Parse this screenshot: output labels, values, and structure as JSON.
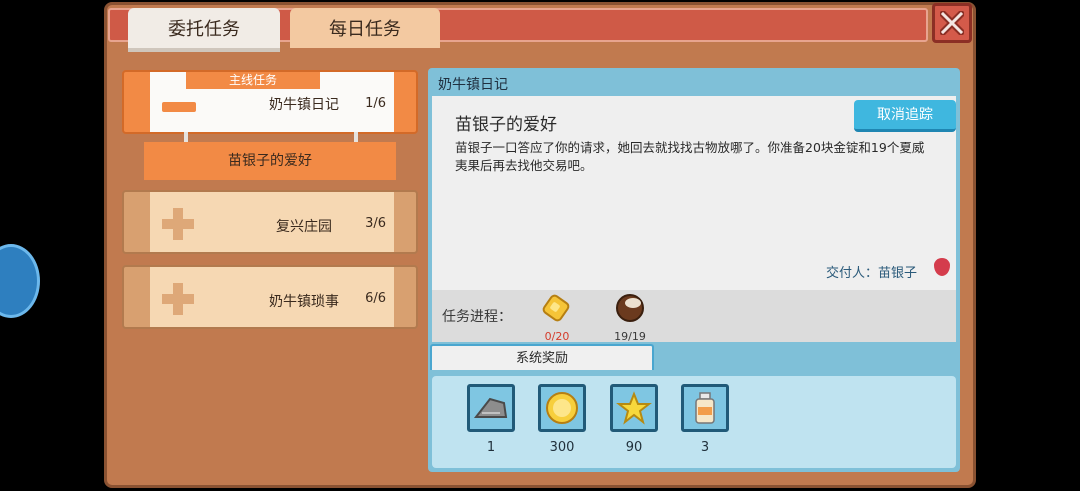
{
  "tabs": {
    "commission": "委托任务",
    "daily": "每日任务"
  },
  "quest_list": {
    "main_ribbon": "主线任务",
    "items": [
      {
        "title": "奶牛镇日记",
        "count": "1/6"
      },
      {
        "title": "复兴庄园",
        "count": "3/6"
      },
      {
        "title": "奶牛镇琐事",
        "count": "6/6"
      }
    ],
    "sub_item": "苗银子的爱好"
  },
  "detail": {
    "header": "奶牛镇日记",
    "quest_name": "苗银子的爱好",
    "description": "苗银子一口答应了你的请求，她回去就找找古物放哪了。你准备20块金锭和19个夏威夷果后再去找他交易吧。",
    "untrack_button": "取消追踪",
    "giver": "交付人：苗银子",
    "progress_label": "任务进程：",
    "requirements": [
      {
        "icon": "gold-ingot-icon",
        "value": "0/20"
      },
      {
        "icon": "macadamia-nut-icon",
        "value": "19/19"
      }
    ],
    "rewards_tab": "系统奖励",
    "rewards": [
      {
        "icon": "cloth-icon",
        "value": "1"
      },
      {
        "icon": "gold-coin-icon",
        "value": "300"
      },
      {
        "icon": "star-icon",
        "value": "90"
      },
      {
        "icon": "milk-bottle-icon",
        "value": "3"
      }
    ]
  },
  "colors": {
    "accent_orange": "#f28a45",
    "panel_blue": "#7fc0d8",
    "button_blue": "#3fb7df",
    "warn_red": "#d43c2c"
  }
}
